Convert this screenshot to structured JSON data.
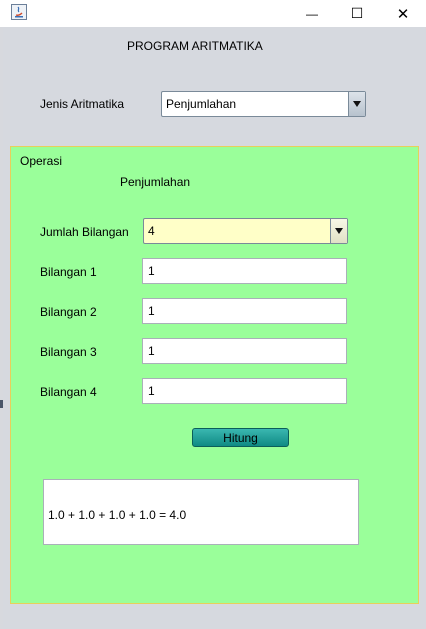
{
  "window": {
    "minimize_glyph": "—",
    "maximize_glyph": "☐",
    "close_glyph": "✕"
  },
  "header": {
    "title": "PROGRAM ARITMATIKA",
    "jenis_label": "Jenis Aritmatika",
    "jenis_selected": "Penjumlahan"
  },
  "operasi": {
    "panel_label": "Operasi",
    "operation_name": "Penjumlahan",
    "jumlah_label": "Jumlah Bilangan",
    "jumlah_selected": "4",
    "fields": [
      {
        "label": "Bilangan 1",
        "value": "1"
      },
      {
        "label": "Bilangan 2",
        "value": "1"
      },
      {
        "label": "Bilangan 3",
        "value": "1"
      },
      {
        "label": "Bilangan 4",
        "value": "1"
      }
    ],
    "button_label": "Hitung",
    "result": "1.0 + 1.0 + 1.0 + 1.0 = 4.0"
  },
  "colors": {
    "panel_bg": "#9aff9a",
    "panel_border": "#e8cf5a",
    "jumlah_combo_bg": "#ffffc8",
    "button": "#1a9c95"
  }
}
